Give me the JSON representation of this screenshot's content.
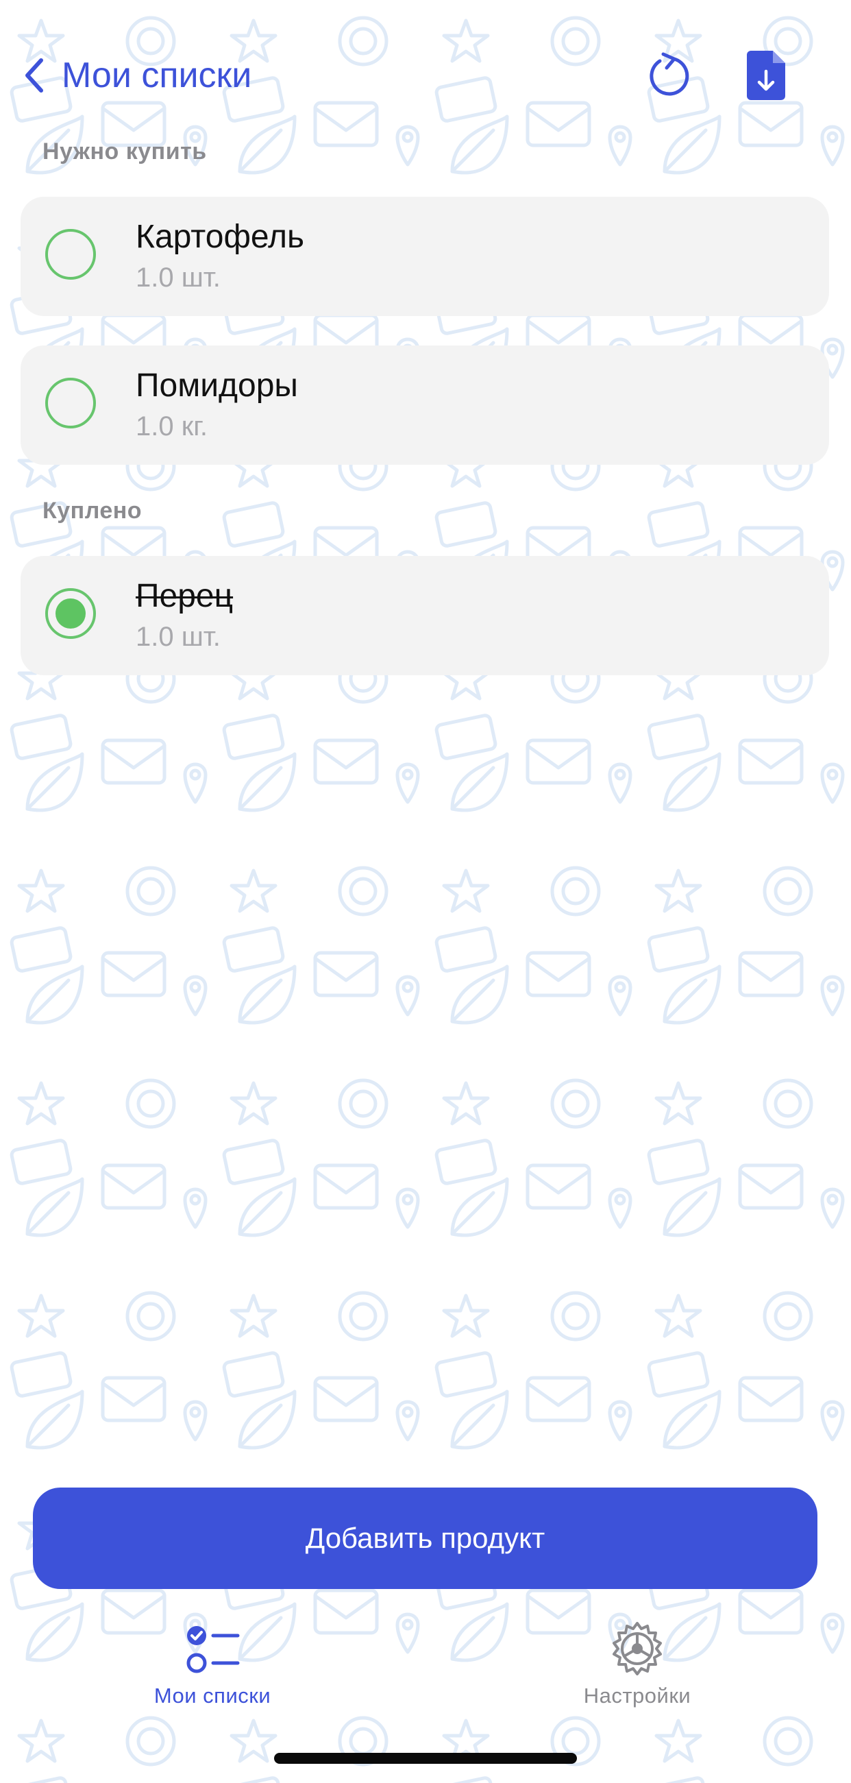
{
  "header": {
    "back_label": "Мои списки",
    "refresh_icon": "refresh-icon",
    "export_icon": "file-download-icon"
  },
  "sections": {
    "to_buy_label": "Нужно купить",
    "bought_label": "Куплено"
  },
  "items": [
    {
      "name": "Картофель",
      "quantity": "1.0 шт.",
      "checked": false
    },
    {
      "name": "Помидоры",
      "quantity": "1.0 кг.",
      "checked": false
    },
    {
      "name": "Перец",
      "quantity": "1.0 шт.",
      "checked": true
    }
  ],
  "add_button": {
    "label": "Добавить продукт"
  },
  "tabbar": {
    "lists_label": "Мои списки",
    "settings_label": "Настройки"
  },
  "colors": {
    "accent": "#3d52d9",
    "check_green": "#5ec462",
    "card_bg": "#f3f3f3",
    "secondary_text": "#8a8a8e"
  }
}
